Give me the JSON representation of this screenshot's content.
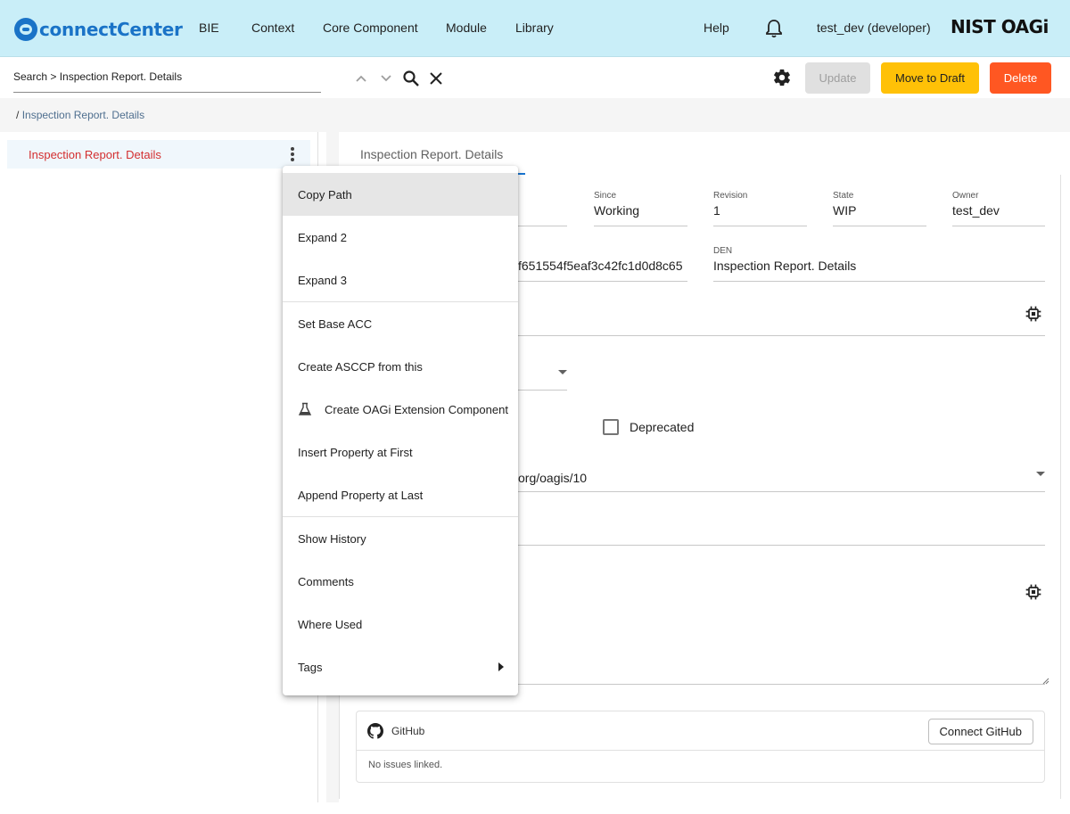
{
  "app": {
    "logo_text": "connectCenter",
    "nav": [
      "BIE",
      "Context",
      "Core Component",
      "Module",
      "Library"
    ],
    "help": "Help",
    "user": "test_dev (developer)",
    "org_logo": "NIST OAGi",
    "accent": "#1a73c7",
    "header_bg": "#c9eef8"
  },
  "search": {
    "value": "Search > Inspection Report. Details"
  },
  "toolbar": {
    "update_label": "Update",
    "draft_label": "Move to Draft",
    "delete_label": "Delete",
    "draft_color": "#ffc107",
    "delete_color": "#ff5722"
  },
  "breadcrumb": {
    "separator": "/",
    "current": "Inspection Report. Details"
  },
  "tree": {
    "root_label": "Inspection Report. Details"
  },
  "main": {
    "tab_label": "Inspection Report. Details",
    "fields": {
      "since_label": "Since",
      "since_value": "Working",
      "revision_label": "Revision",
      "revision_value": "1",
      "state_label": "State",
      "state_value": "WIP",
      "owner_label": "Owner",
      "owner_value": "test_dev",
      "guid_partial": "f651554f5eaf3c42fc1d0d8c65",
      "den_label": "DEN",
      "den_value": "Inspection Report. Details",
      "namespace_partial": "org/oagis/10"
    },
    "deprecated_label": "Deprecated",
    "github": {
      "title": "GitHub",
      "connect_label": "Connect GitHub",
      "empty_text": "No issues linked."
    }
  },
  "context_menu": {
    "items": [
      "Copy Path",
      "Expand 2",
      "Expand 3",
      "Set Base ACC",
      "Create ASCCP from this",
      "Create OAGi Extension Component",
      "Insert Property at First",
      "Append Property at Last",
      "Show History",
      "Comments",
      "Where Used",
      "Tags"
    ]
  }
}
